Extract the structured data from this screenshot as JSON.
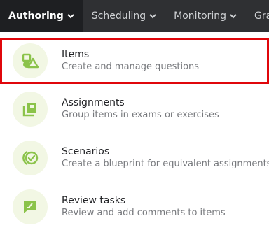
{
  "nav": {
    "tabs": [
      {
        "label": "Authoring",
        "active": true
      },
      {
        "label": "Scheduling",
        "active": false
      },
      {
        "label": "Monitoring",
        "active": false
      },
      {
        "label": "Gra",
        "active": false
      }
    ]
  },
  "menu": {
    "items": [
      {
        "title": "Items",
        "description": "Create and manage questions",
        "icon": "shapes-icon",
        "selected": true
      },
      {
        "title": "Assignments",
        "description": "Group items in exams or exercises",
        "icon": "stacked-pages-icon",
        "selected": false
      },
      {
        "title": "Scenarios",
        "description": "Create a blueprint for equivalent assignments",
        "icon": "circled-check-icon",
        "selected": false
      },
      {
        "title": "Review tasks",
        "description": "Review and add comments to items",
        "icon": "comment-icon",
        "selected": false
      }
    ]
  },
  "colors": {
    "topbar": "#2f3033",
    "active_tab": "#1e1f22",
    "icon_green": "#8bc34a",
    "icon_bg": "#f2f7e4",
    "highlight": "#e0060b"
  }
}
